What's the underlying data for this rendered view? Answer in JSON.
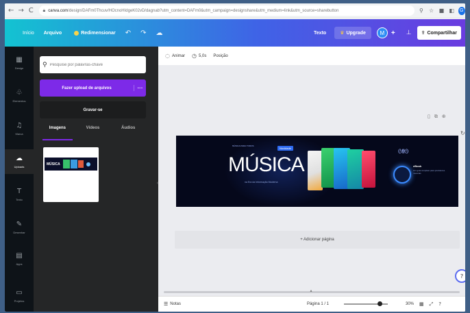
{
  "browser": {
    "back": "←",
    "forward": "→",
    "reload": "C",
    "url_domain": "canva.com",
    "url_path": "/design/DAFm0Thcuv/HOcnoHIdgeK02vD/dagnab?utm_content=DAFm0&utm_campaign=designshare&utm_medium=link&utm_source=sharebutton",
    "icon_key": "⚲",
    "icon_star": "☆",
    "icon_ext": "■",
    "icon_puzzle": "◧",
    "avatar_letter": "G"
  },
  "topbar": {
    "home": "Início",
    "file": "Arquivo",
    "saved": "Redimensionar",
    "undo": "↶",
    "redo": "↷",
    "cloud": "☁",
    "pro_label": "Texto",
    "upgrade": "Upgrade",
    "crown": "♛",
    "avatar": "M",
    "plus": "+",
    "chart": "⊥",
    "share_icon": "⇪",
    "share": "Compartilhar"
  },
  "rail": [
    {
      "icon": "▦",
      "label": "Design"
    },
    {
      "icon": "♧",
      "label": "Elementos"
    },
    {
      "icon": "♫",
      "label": "Marca"
    },
    {
      "icon": "☁",
      "label": "Uploads"
    },
    {
      "icon": "T",
      "label": "Texto"
    },
    {
      "icon": "✎",
      "label": "Desenhar"
    },
    {
      "icon": "▤",
      "label": "Apps"
    },
    {
      "icon": "▭",
      "label": "Projetos"
    }
  ],
  "panel": {
    "search_icon": "⚲",
    "search_placeholder": "Pesquise por palavras-chave",
    "upload_label": "Fazer upload de arquivos",
    "upload_more": "···",
    "record_label": "Gravar-se",
    "tabs": [
      "Imagens",
      "Vídeos",
      "Áudios"
    ],
    "thumb_text": "MÚSICA",
    "collapse": "‹"
  },
  "editor": {
    "ctx_items": [
      {
        "icon": "◌",
        "label": "Animar"
      },
      {
        "icon": "◷",
        "label": "5,0s"
      },
      {
        "icon": "",
        "label": "Posição"
      }
    ],
    "page_tools": [
      "▯",
      "⧉",
      "⊕"
    ],
    "refresh": "↻",
    "banner": {
      "small_top": "MÚSICA PARA TODOS",
      "badge": "Novidade",
      "title": "MÚSICA",
      "subtitle": "na Era da Informação Moderna",
      "side_title": "eBook",
      "side_sub": "Um guia completo para produtores musicais"
    },
    "add_page": "+ Adicionar página",
    "help": "?"
  },
  "footer": {
    "notes_icon": "☰",
    "notes": "Notas",
    "page": "Página 1 / 1",
    "zoom_level": 0.82,
    "zoom_value": "30%",
    "grid_icon": "▦",
    "full_icon": "⤢",
    "help_icon": "?",
    "scroll_handle": "▴"
  }
}
